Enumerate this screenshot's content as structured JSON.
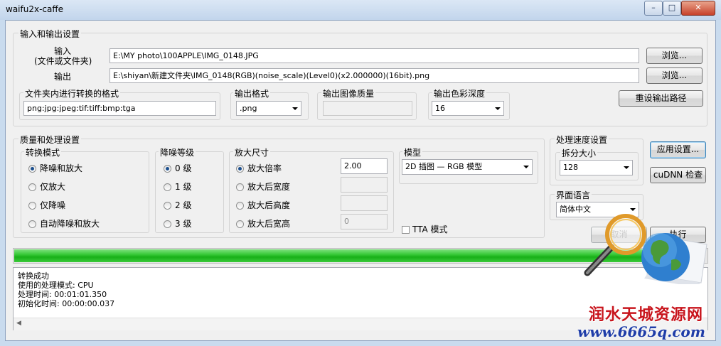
{
  "window": {
    "title": "waifu2x-caffe",
    "min_glyph": "–",
    "max_glyph": "□",
    "close_glyph": "✕"
  },
  "io": {
    "group_label": "输入和输出设置",
    "input_label_1": "输入",
    "input_label_2": "(文件或文件夹)",
    "input_value": "E:\\MY photo\\100APPLE\\IMG_0148.JPG",
    "browse_label": "浏览...",
    "output_label": "输出",
    "output_value": "E:\\shiyan\\新建文件夹\\IMG_0148(RGB)(noise_scale)(Level0)(x2.000000)(16bit).png",
    "browse2_label": "浏览...",
    "ext_label": "文件夹内进行转换的格式",
    "ext_value": "png:jpg:jpeg:tif:tiff:bmp:tga",
    "format_label": "输出格式",
    "format_value": ".png",
    "quality_label": "输出图像质量",
    "quality_value": "",
    "depth_label": "输出色彩深度",
    "depth_value": "16",
    "reset_label": "重设输出路径"
  },
  "quality": {
    "group_label": "质量和处理设置",
    "mode_label": "转换模式",
    "modes": [
      "降噪和放大",
      "仅放大",
      "仅降噪",
      "自动降噪和放大"
    ],
    "mode_selected": 0,
    "noise_label": "降噪等级",
    "noise_levels": [
      "0 级",
      "1 级",
      "2 级",
      "3 级"
    ],
    "noise_selected": 0,
    "scale_label": "放大尺寸",
    "scale_options": [
      "放大倍率",
      "放大后宽度",
      "放大后高度",
      "放大后宽高"
    ],
    "scale_selected": 0,
    "scale_values": [
      "2.00",
      "",
      "",
      "0"
    ],
    "model_label": "模型",
    "model_value": "2D 插图 — RGB 模型",
    "tta_label": "TTA 模式"
  },
  "speed": {
    "group_label": "处理速度设置",
    "split_label": "拆分大小",
    "split_value": "128",
    "apply_label": "应用设置...",
    "cudnn_label": "cuDNN 检查"
  },
  "language": {
    "group_label": "界面语言",
    "value": "简体中文"
  },
  "actions": {
    "cancel_label": "取消",
    "run_label": "执行"
  },
  "progress": {
    "value": 0.99
  },
  "log": {
    "lines": [
      "转换成功",
      "使用的处理模式: CPU",
      "处理时间: 00:01:01.350",
      "初始化时间: 00:00:00.037"
    ]
  },
  "watermark": {
    "text": "润水天城资源网",
    "url": "www.6665q.com"
  },
  "colors": {
    "progress_green": "#1fb51f",
    "window_blue": "#c9dbee"
  }
}
